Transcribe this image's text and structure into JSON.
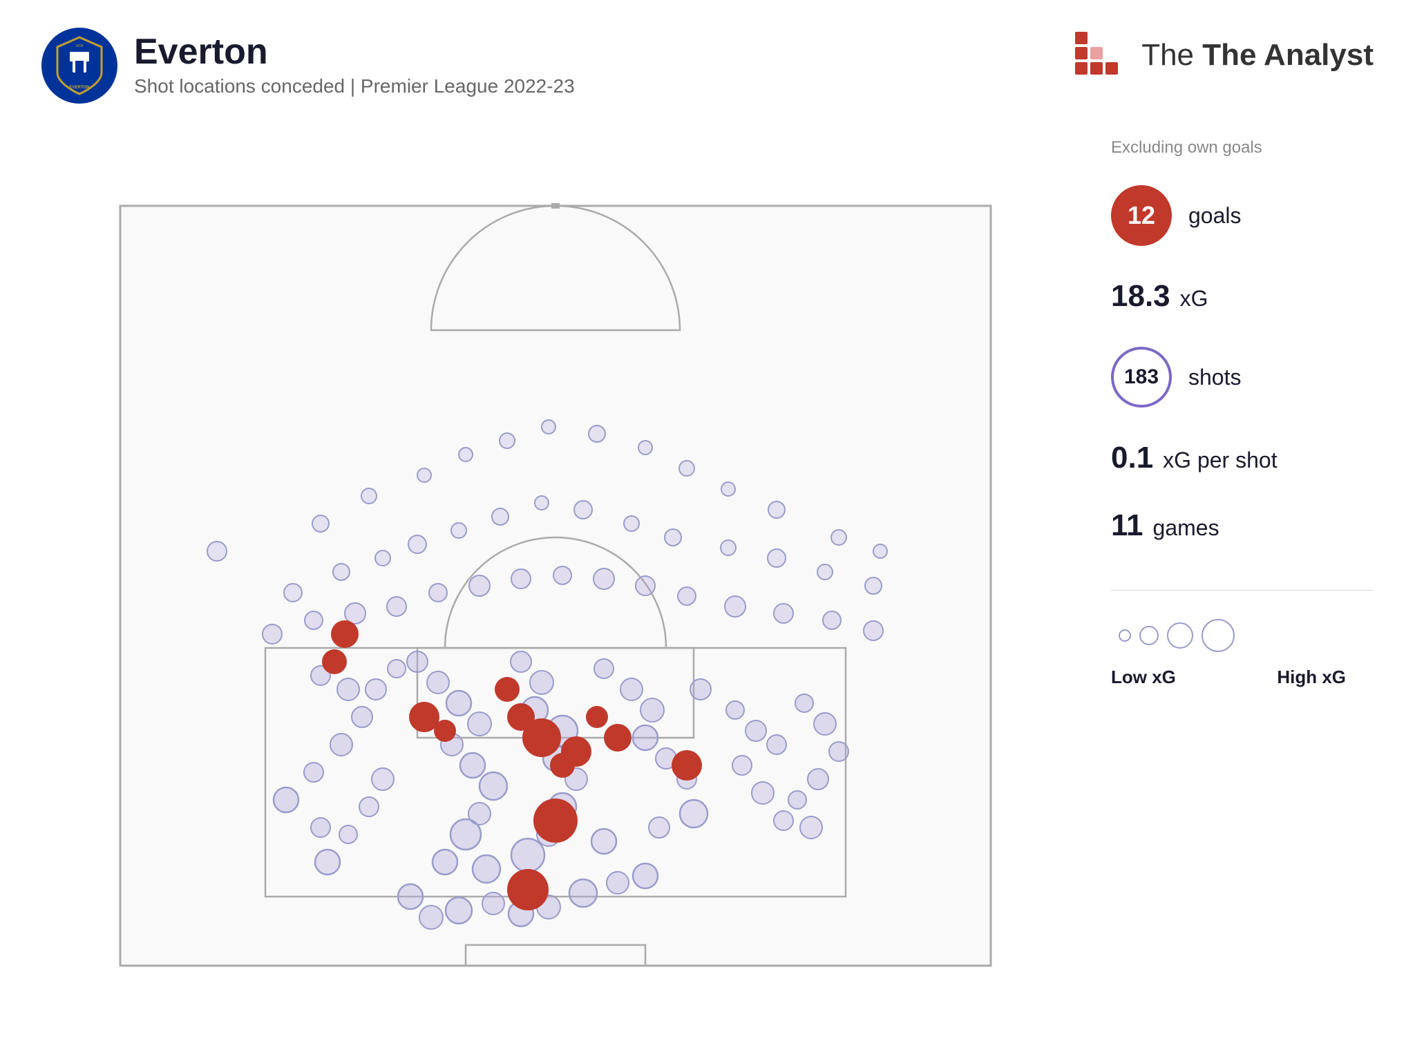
{
  "header": {
    "team_name": "Everton",
    "subtitle": "Shot locations conceded | Premier League 2022-23",
    "analyst_brand": "The Analyst"
  },
  "stats": {
    "excluding_label": "Excluding own goals",
    "goals_value": "12",
    "goals_label": "goals",
    "xg_value": "18.3",
    "xg_label": "xG",
    "shots_value": "183",
    "shots_label": "shots",
    "xg_per_shot_value": "0.1",
    "xg_per_shot_label": "xG per shot",
    "games_value": "11",
    "games_label": "games",
    "legend_low": "Low xG",
    "legend_high": "High xG"
  },
  "colors": {
    "goal_dot": "#c0392b",
    "shot_dot_fill": "rgba(180,170,220,0.35)",
    "shot_dot_stroke": "#9b9bcc",
    "pitch_line": "#aaa",
    "pitch_bg": "#f8f8f8"
  }
}
